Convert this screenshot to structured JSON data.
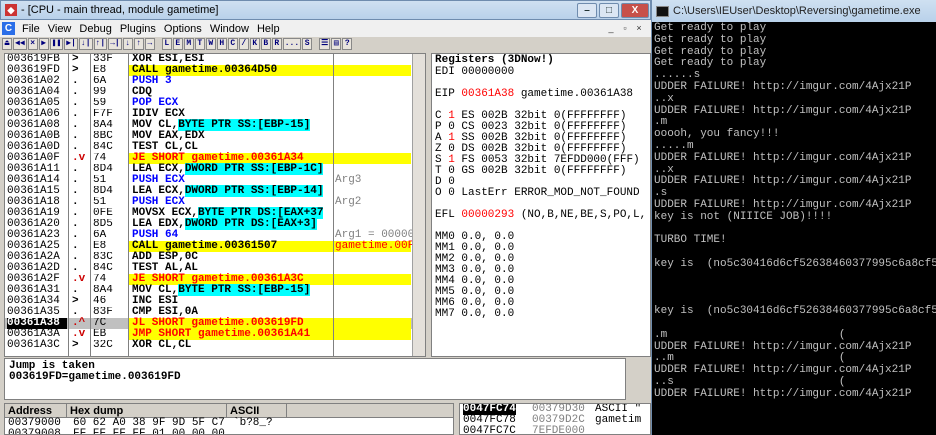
{
  "olly": {
    "title": "- [CPU - main thread, module gametime]",
    "window_buttons": {
      "min": "–",
      "max": "□",
      "close": "X"
    },
    "mdi_buttons": {
      "min": "_",
      "max": "▫",
      "close": "×"
    },
    "menu": [
      "File",
      "View",
      "Debug",
      "Plugins",
      "Options",
      "Window",
      "Help"
    ],
    "toolbar": [
      "⏏",
      "◀◀",
      "×",
      "▶",
      "❚❚",
      "▶|",
      "↓|",
      "↑|",
      "→|",
      "↓",
      "↑",
      "→",
      "L",
      "E",
      "M",
      "T",
      "W",
      "H",
      "C",
      "/",
      "K",
      "B",
      "R",
      "...",
      "S",
      "☰",
      "▤",
      "?"
    ]
  },
  "cpu_rows": [
    {
      "addr": "003619FB",
      "arrow": ">",
      "hex": "33F",
      "dis": "XOR ESI,ESI",
      "style": "",
      "cmt": "",
      "cmt_style": ""
    },
    {
      "addr": "003619FD",
      "arrow": ">",
      "hex": "E8",
      "dis": "CALL gametime.00364D50",
      "style": "call",
      "cmt": "",
      "cmt_style": ""
    },
    {
      "addr": "00361A02",
      "arrow": ".",
      "hex": "6A",
      "dis": "PUSH 3",
      "style": "push",
      "cmt": "",
      "cmt_style": ""
    },
    {
      "addr": "00361A04",
      "arrow": ".",
      "hex": "99",
      "dis": "CDQ",
      "style": "",
      "cmt": "",
      "cmt_style": ""
    },
    {
      "addr": "00361A05",
      "arrow": ".",
      "hex": "59",
      "dis": "POP ECX",
      "style": "push",
      "cmt": "",
      "cmt_style": ""
    },
    {
      "addr": "00361A06",
      "arrow": ".",
      "hex": "F7F",
      "dis": "IDIV ECX",
      "style": "",
      "cmt": "",
      "cmt_style": ""
    },
    {
      "addr": "00361A08",
      "arrow": ".",
      "hex": "8A4",
      "dis": "MOV CL,BYTE PTR SS:[EBP-15]",
      "style": "mem",
      "cmt": "",
      "cmt_style": ""
    },
    {
      "addr": "00361A0B",
      "arrow": ".",
      "hex": "8BC",
      "dis": "MOV EAX,EDX",
      "style": "",
      "cmt": "",
      "cmt_style": ""
    },
    {
      "addr": "00361A0D",
      "arrow": ".",
      "hex": "84C",
      "dis": "TEST CL,CL",
      "style": "",
      "cmt": "",
      "cmt_style": ""
    },
    {
      "addr": "00361A0F",
      "arrow": ".v",
      "hex": "74",
      "dis": "JE SHORT gametime.00361A34",
      "style": "jump",
      "cmt": "",
      "cmt_style": ""
    },
    {
      "addr": "00361A11",
      "arrow": ".",
      "hex": "8D4",
      "dis": "LEA ECX,DWORD PTR SS:[EBP-1C]",
      "style": "mem",
      "cmt": "",
      "cmt_style": ""
    },
    {
      "addr": "00361A14",
      "arrow": ".",
      "hex": "51",
      "dis": "PUSH ECX",
      "style": "push",
      "cmt": "Arg3",
      "cmt_style": "arg"
    },
    {
      "addr": "00361A15",
      "arrow": ".",
      "hex": "8D4",
      "dis": "LEA ECX,DWORD PTR SS:[EBP-14]",
      "style": "mem",
      "cmt": "",
      "cmt_style": ""
    },
    {
      "addr": "00361A18",
      "arrow": ".",
      "hex": "51",
      "dis": "PUSH ECX",
      "style": "push",
      "cmt": "Arg2",
      "cmt_style": "arg"
    },
    {
      "addr": "00361A19",
      "arrow": ".",
      "hex": "0FE",
      "dis": "MOVSX ECX,BYTE PTR DS:[EAX+37",
      "style": "mem",
      "cmt": "",
      "cmt_style": ""
    },
    {
      "addr": "00361A20",
      "arrow": ".",
      "hex": "8D5",
      "dis": "LEA EDX,DWORD PTR DS:[EAX+3]",
      "style": "mem",
      "cmt": "",
      "cmt_style": ""
    },
    {
      "addr": "00361A23",
      "arrow": ".",
      "hex": "6A",
      "dis": "PUSH 64",
      "style": "push",
      "cmt": "Arg1 = 000000",
      "cmt_style": "arg"
    },
    {
      "addr": "00361A25",
      "arrow": ".",
      "hex": "E8",
      "dis": "CALL gametime.00361507",
      "style": "call",
      "cmt": "gametime.00F8",
      "cmt_style": "red"
    },
    {
      "addr": "00361A2A",
      "arrow": ".",
      "hex": "83C",
      "dis": "ADD ESP,0C",
      "style": "",
      "cmt": "",
      "cmt_style": ""
    },
    {
      "addr": "00361A2D",
      "arrow": ".",
      "hex": "84C",
      "dis": "TEST AL,AL",
      "style": "",
      "cmt": "",
      "cmt_style": ""
    },
    {
      "addr": "00361A2F",
      "arrow": ".v",
      "hex": "74",
      "dis": "JE SHORT gametime.00361A3C",
      "style": "jump",
      "cmt": "",
      "cmt_style": ""
    },
    {
      "addr": "00361A31",
      "arrow": ".",
      "hex": "8A4",
      "dis": "MOV CL,BYTE PTR SS:[EBP-15]",
      "style": "mem",
      "cmt": "",
      "cmt_style": ""
    },
    {
      "addr": "00361A34",
      "arrow": ">",
      "hex": "46",
      "dis": "INC ESI",
      "style": "",
      "cmt": "",
      "cmt_style": ""
    },
    {
      "addr": "00361A35",
      "arrow": ".",
      "hex": "83F",
      "dis": "CMP ESI,0A",
      "style": "",
      "cmt": "",
      "cmt_style": ""
    },
    {
      "addr": "00361A38",
      "arrow": ".^",
      "hex": "7C",
      "dis": "JL SHORT gametime.003619FD",
      "style": "jump",
      "cmt": "",
      "cmt_style": "",
      "selected": true
    },
    {
      "addr": "00361A3A",
      "arrow": ".v",
      "hex": "EB",
      "dis": "JMP SHORT gametime.00361A41",
      "style": "jump",
      "cmt": "",
      "cmt_style": ""
    },
    {
      "addr": "00361A3C",
      "arrow": ">",
      "hex": "32C",
      "dis": "XOR CL,CL",
      "style": "",
      "cmt": "",
      "cmt_style": ""
    }
  ],
  "info": {
    "line1": "Jump is taken",
    "line2": "003619FD=gametime.003619FD"
  },
  "regs": {
    "header": "Registers (3DNow!)",
    "lines": [
      {
        "t": "EDI 00000000",
        "hl": ""
      },
      {
        "t": "",
        "hl": ""
      },
      {
        "t": "EIP 00361A38 gametime.00361A38",
        "hl": "eip"
      },
      {
        "t": "",
        "hl": ""
      },
      {
        "t": "C 1  ES 002B 32bit 0(FFFFFFFF)",
        "hl": "flag"
      },
      {
        "t": "P 0  CS 0023 32bit 0(FFFFFFFF)",
        "hl": ""
      },
      {
        "t": "A 1  SS 002B 32bit 0(FFFFFFFF)",
        "hl": "flag"
      },
      {
        "t": "Z 0  DS 002B 32bit 0(FFFFFFFF)",
        "hl": ""
      },
      {
        "t": "S 1  FS 0053 32bit 7EFDD000(FFF)",
        "hl": "flag"
      },
      {
        "t": "T 0  GS 002B 32bit 0(FFFFFFFF)",
        "hl": ""
      },
      {
        "t": "D 0",
        "hl": ""
      },
      {
        "t": "O 0  LastErr ERROR_MOD_NOT_FOUND",
        "hl": ""
      },
      {
        "t": "",
        "hl": ""
      },
      {
        "t": "EFL 00000293 (NO,B,NE,BE,S,PO,L,",
        "hl": "efl"
      },
      {
        "t": "",
        "hl": ""
      },
      {
        "t": "MM0               0.0,          0.0",
        "hl": ""
      },
      {
        "t": "MM1               0.0,          0.0",
        "hl": ""
      },
      {
        "t": "MM2               0.0,          0.0",
        "hl": ""
      },
      {
        "t": "MM3               0.0,          0.0",
        "hl": ""
      },
      {
        "t": "MM4               0.0,          0.0",
        "hl": ""
      },
      {
        "t": "MM5               0.0,          0.0",
        "hl": ""
      },
      {
        "t": "MM6               0.0,          0.0",
        "hl": ""
      },
      {
        "t": "MM7               0.0,          0.0",
        "hl": ""
      }
    ]
  },
  "dump": {
    "headers": [
      "Address",
      "Hex dump",
      "ASCII"
    ],
    "rows": [
      {
        "addr": "00379000",
        "hex": "60 62 A0 38 9F 9D 5F C7",
        "ascii": "`b?8_?"
      },
      {
        "addr": "00379008",
        "hex": "FF FF FF FF 01 00 00 00",
        "ascii": ""
      }
    ]
  },
  "stack": {
    "rows": [
      {
        "addr": "0047FC74",
        "val": "00379D30",
        "cmt": "ASCII \"",
        "sel": true
      },
      {
        "addr": "0047FC78",
        "val": "00379D2C",
        "cmt": "gametim",
        "sel": false
      },
      {
        "addr": "0047FC7C",
        "val": "7EFDE000",
        "cmt": "",
        "sel": false
      }
    ]
  },
  "cmd": {
    "title": "C:\\Users\\IEUser\\Desktop\\Reversing\\gametime.exe",
    "lines": [
      "Get ready to play",
      "Get ready to play",
      "Get ready to play",
      "Get ready to play",
      "......s",
      "UDDER FAILURE! http://imgur.com/4Ajx21P",
      "..x",
      "UDDER FAILURE! http://imgur.com/4Ajx21P",
      ".m",
      "ooooh, you fancy!!!",
      ".....m",
      "UDDER FAILURE! http://imgur.com/4Ajx21P",
      "..x",
      "UDDER FAILURE! http://imgur.com/4Ajx21P",
      ".s",
      "UDDER FAILURE! http://imgur.com/4Ajx21P",
      "key is not (NIIICE JOB)!!!!",
      "",
      "TURBO TIME!",
      "",
      "key is  (no5c30416d6cf52638460377995c6a8cf5)",
      "",
      "",
      "",
      "key is  (no5c30416d6cf52638460377995c6a8cf5)",
      "",
      ".m                          (",
      "UDDER FAILURE! http://imgur.com/4Ajx21P",
      "..m                         (",
      "UDDER FAILURE! http://imgur.com/4Ajx21P",
      "..s                         (",
      "UDDER FAILURE! http://imgur.com/4Ajx21P",
      ""
    ]
  },
  "colors": {
    "call_bg": "#ffff00",
    "push_fg": "#0000ff",
    "jump_bg": "#ffff00",
    "jump_fg": "#ff0000",
    "mem_bg": "#00ffff",
    "selection": "#c0c0c0",
    "arg_fg": "#808080",
    "red_fg": "#ff0000"
  }
}
